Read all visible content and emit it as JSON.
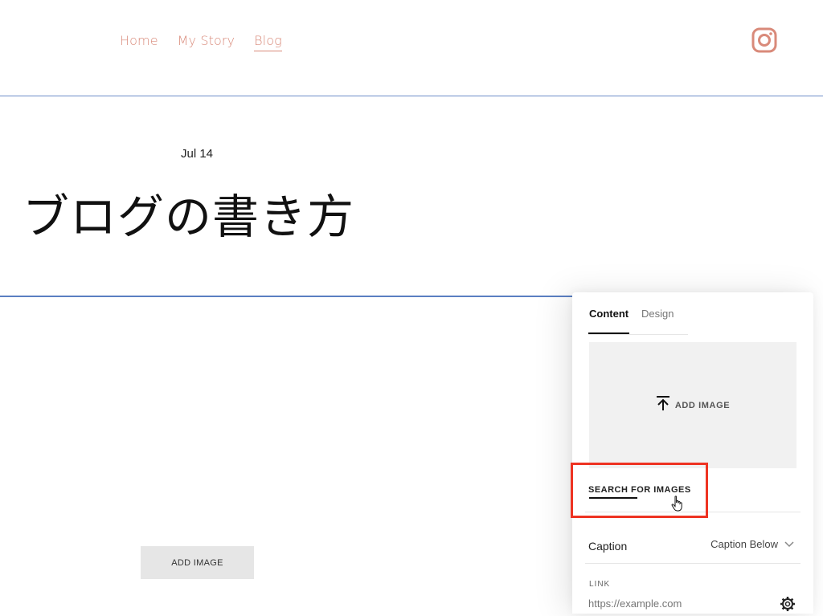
{
  "nav": {
    "items": [
      {
        "label": "Home"
      },
      {
        "label": "My Story"
      },
      {
        "label": "Blog",
        "active": true
      }
    ],
    "social_icon": "instagram-icon",
    "accent_color": "#d98a7a"
  },
  "post": {
    "date": "Jul 14",
    "title": "ブログの書き方"
  },
  "page_image_block": {
    "label": "ADD IMAGE"
  },
  "panel": {
    "tabs": [
      {
        "label": "Content",
        "active": true
      },
      {
        "label": "Design"
      }
    ],
    "dropzone": {
      "label": "ADD IMAGE",
      "icon": "upload-icon"
    },
    "search_images": "SEARCH FOR IMAGES",
    "caption": {
      "label": "Caption",
      "value": "Caption Below"
    },
    "link": {
      "label": "LINK",
      "placeholder": "https://example.com",
      "icon": "gear-icon"
    }
  },
  "highlight_color": "#ee3322"
}
